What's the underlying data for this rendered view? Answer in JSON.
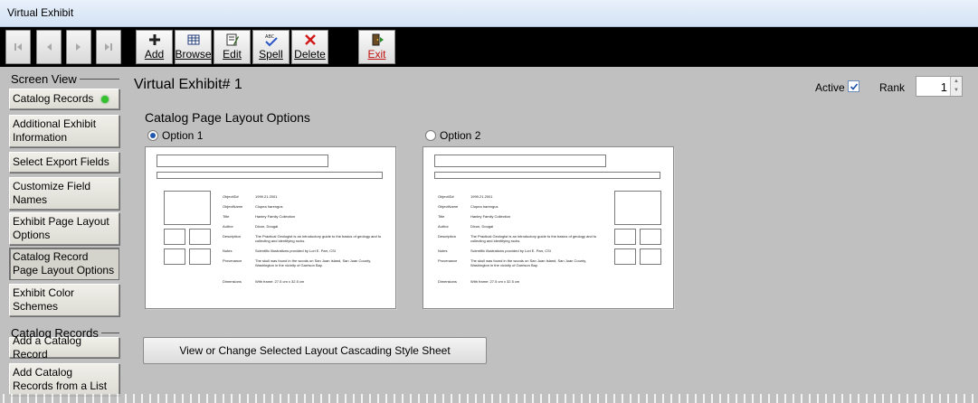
{
  "window": {
    "title": "Virtual Exhibit"
  },
  "toolbar": {
    "buttons": [
      {
        "label": "Add",
        "icon": "plus-icon"
      },
      {
        "label": "Browse",
        "icon": "grid-icon"
      },
      {
        "label": "Edit",
        "icon": "edit-icon"
      },
      {
        "label": "Spell",
        "icon": "spell-check-icon"
      },
      {
        "label": "Delete",
        "icon": "delete-x-icon"
      },
      {
        "label": "Exit",
        "icon": "exit-door-icon"
      }
    ]
  },
  "sidebar": {
    "screen_view_heading": "Screen View",
    "screen_view_items": [
      "Catalog Records",
      "Additional Exhibit Information",
      "Select Export Fields",
      "Customize Field Names",
      "Exhibit Page Layout Options",
      "Catalog Record Page Layout Options",
      "Exhibit Color Schemes"
    ],
    "catalog_records_heading": "Catalog Records",
    "catalog_records_items": [
      "Add a Catalog Record",
      "Add Catalog Records from a List"
    ]
  },
  "main": {
    "title": "Virtual Exhibit# 1",
    "active_label": "Active",
    "active_checked": true,
    "rank_label": "Rank",
    "rank_value": "1",
    "layout_heading": "Catalog Page Layout Options",
    "option1_label": "Option 1",
    "option2_label": "Option 2",
    "selected_option": 1,
    "css_button_label": "View or Change Selected Layout Cascading Style Sheet"
  },
  "preview_fields": [
    {
      "key": "ObjectID#",
      "value": "1999.21.2001"
    },
    {
      "key": "ObjectName",
      "value": "Clupea harengus"
    },
    {
      "key": "Title",
      "value": "Hanley Family Collection"
    },
    {
      "key": "Author",
      "value": "Dixon, Dougal"
    },
    {
      "key": "Description",
      "value": "The Practical Geologist is an introductory guide to the basics of geology and to collecting and identifying rocks."
    },
    {
      "key": "Notes",
      "value": "Scientific illustrations provided by Lori E. Parr, CSI"
    },
    {
      "key": "Provenance",
      "value": "The skull was found in the woods on San Juan Island, San Juan County, Washington in the vicinity of Garrison Bay."
    },
    {
      "key": "Dimensions",
      "value": "With frame: 27.5 cm x 32.5 cm"
    }
  ],
  "colors": {
    "active_dot": "#33c12e",
    "radio_fill": "#1f57b0",
    "delete_icon": "#d11a1a"
  }
}
